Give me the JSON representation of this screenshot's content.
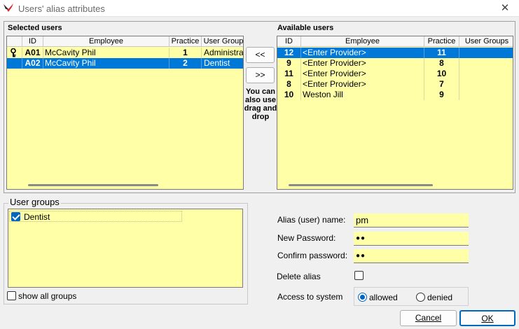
{
  "window": {
    "title": "Users' alias attributes",
    "close_glyph": "✕"
  },
  "selected_users": {
    "title": "Selected users",
    "columns": [
      "ID",
      "Employee",
      "Practice",
      "User Group"
    ],
    "rows": [
      {
        "id": "A01",
        "employee": "McCavity Phil",
        "practice": "1",
        "group": "Administrat",
        "icon": "key-icon"
      },
      {
        "id": "A02",
        "employee": "McCavity Phil",
        "practice": "2",
        "group": "Dentist"
      }
    ]
  },
  "available_users": {
    "title": "Available users",
    "columns": [
      "ID",
      "Employee",
      "Practice",
      "User Groups"
    ],
    "rows": [
      {
        "id": "12",
        "employee": "<Enter Provider>",
        "practice": "11",
        "group": ""
      },
      {
        "id": "9",
        "employee": "<Enter Provider>",
        "practice": "8",
        "group": ""
      },
      {
        "id": "11",
        "employee": "<Enter Provider>",
        "practice": "10",
        "group": ""
      },
      {
        "id": "8",
        "employee": "<Enter Provider>",
        "practice": "7",
        "group": ""
      },
      {
        "id": "10",
        "employee": "Weston Jill",
        "practice": "9",
        "group": ""
      }
    ]
  },
  "transfer": {
    "move_left": "<<",
    "move_right": ">>",
    "hint": "You can also use drag and drop"
  },
  "user_groups": {
    "title": "User groups",
    "items": [
      {
        "label": "Dentist",
        "checked": true
      }
    ],
    "show_all_label": "show all groups"
  },
  "form": {
    "alias_label": "Alias (user) name:",
    "alias_value": "pm",
    "new_password_label": "New Password:",
    "new_password_value": "●●",
    "confirm_password_label": "Confirm password:",
    "confirm_password_value": "●●",
    "delete_alias_label": "Delete alias",
    "access_label": "Access to system",
    "access_options": [
      "allowed",
      "denied"
    ],
    "access_selected": "allowed"
  },
  "buttons": {
    "cancel": "Cancel",
    "ok": "OK"
  },
  "colors": {
    "grid_bg": "#ffffa8",
    "selection": "#0078d7",
    "accent": "#0067c0"
  }
}
